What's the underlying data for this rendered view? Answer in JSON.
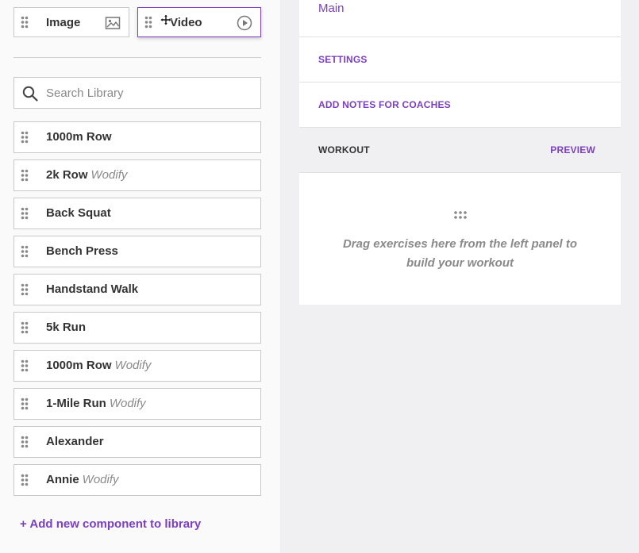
{
  "components": {
    "image": {
      "label": "Image",
      "icon": "image-icon"
    },
    "video": {
      "label": "Video",
      "icon": "play-circle-icon"
    }
  },
  "search": {
    "placeholder": "Search Library",
    "value": ""
  },
  "library": {
    "items": [
      {
        "name": "1000m Row",
        "tag": ""
      },
      {
        "name": "2k Row",
        "tag": "Wodify"
      },
      {
        "name": "Back Squat",
        "tag": ""
      },
      {
        "name": "Bench Press",
        "tag": ""
      },
      {
        "name": "Handstand Walk",
        "tag": ""
      },
      {
        "name": "5k Run",
        "tag": ""
      },
      {
        "name": "1000m Row",
        "tag": "Wodify"
      },
      {
        "name": "1-Mile Run",
        "tag": "Wodify"
      },
      {
        "name": "Alexander",
        "tag": ""
      },
      {
        "name": "Annie",
        "tag": "Wodify"
      }
    ],
    "add_label": "+ Add new component to library"
  },
  "workout_panel": {
    "main_label": "Main",
    "settings_label": "SETTINGS",
    "notes_label": "ADD NOTES FOR COACHES",
    "workout_label": "WORKOUT",
    "preview_label": "PREVIEW",
    "drop_hint": "Drag exercises here from the left panel to build your workout"
  },
  "colors": {
    "accent": "#7b3fc1",
    "border": "#c8c8c8",
    "muted_text": "#8a8a8a",
    "background": "#f0f0f2"
  }
}
